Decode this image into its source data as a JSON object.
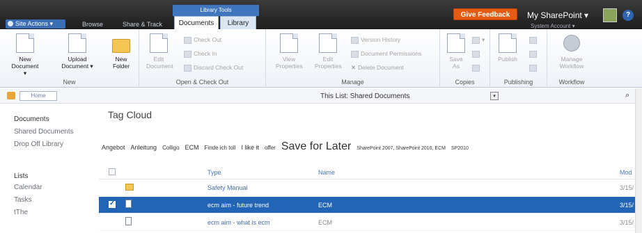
{
  "topbar": {
    "site_actions": "Site Actions",
    "browse_tab": "Browse",
    "share_track_tab": "Share & Track",
    "library_tools": "Library Tools",
    "documents_tab": "Documents",
    "library_tab": "Library",
    "give_feedback": "Give Feedback",
    "my_sharepoint": "My SharePoint ▾",
    "system_account": "System Account ▾"
  },
  "ribbon": {
    "new_group": {
      "label": "New",
      "new_document": "New\nDocument ▾",
      "upload_document": "Upload\nDocument ▾",
      "new_folder": "New\nFolder"
    },
    "open_group": {
      "label": "Open & Check Out",
      "edit_document": "Edit\nDocument",
      "check_out": "Check Out",
      "check_in": "Check In",
      "discard_check_out": "Discard Check Out"
    },
    "manage_group": {
      "label": "Manage",
      "view_properties": "View\nProperties",
      "edit_properties": "Edit\nProperties",
      "version_history": "Version History",
      "document_permissions": "Document Permissions",
      "delete_document": "Delete Document"
    },
    "copies_group": {
      "label": "Copies",
      "save_as": "Save\nAs"
    },
    "publishing_group": {
      "label": "Publishing",
      "publish": "Publish"
    },
    "workflow_group": {
      "label": "Workflow",
      "manage_workflow": "Manage\nWorkflow"
    }
  },
  "navbar": {
    "home": "Home",
    "scope": "This List: Shared Documents"
  },
  "leftnav": {
    "documents_header": "Documents",
    "documents_items": [
      "Shared Documents",
      "Drop Off Library"
    ],
    "lists_header": "Lists",
    "lists_items": [
      "Calendar",
      "Tasks",
      "tThe"
    ]
  },
  "main": {
    "title": "Tag Cloud",
    "tags": [
      {
        "text": "Angebot",
        "size": 9
      },
      {
        "text": "Anleitung",
        "size": 9
      },
      {
        "text": "Colligo",
        "size": 8
      },
      {
        "text": "ECM",
        "size": 9
      },
      {
        "text": "Finde ich toll",
        "size": 8
      },
      {
        "text": "I like it",
        "size": 9
      },
      {
        "text": "offer",
        "size": 8
      },
      {
        "text": "Save for Later",
        "size": 16
      },
      {
        "text": "SharePoint 2007, SharePoint 2010, ECM",
        "size": 7
      },
      {
        "text": "SP2010",
        "size": 7
      }
    ],
    "columns": {
      "type": "Type",
      "name": "Name",
      "modified": "Mod"
    },
    "rows": [
      {
        "icon": "folder-icon",
        "type": "Safety Manual",
        "name": "",
        "modified": "3/15/",
        "selected": false
      },
      {
        "icon": "document-icon",
        "type": "ecm aim - future trend",
        "name": "ECM",
        "modified": "3/15/",
        "selected": true
      },
      {
        "icon": "document-icon",
        "type": "ecm aim - what is ecm",
        "name": "ECM",
        "modified": "3/15/",
        "selected": false
      }
    ]
  }
}
